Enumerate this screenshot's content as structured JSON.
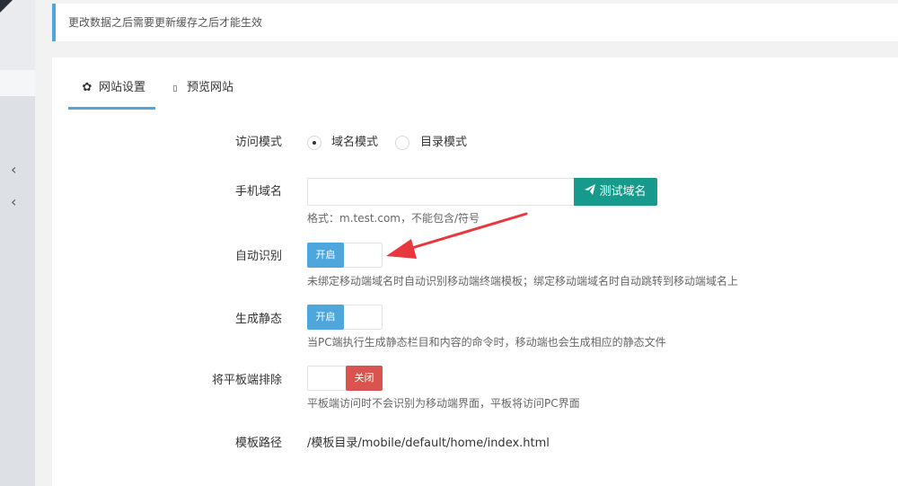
{
  "notice": "更改数据之后需要更新缓存之后才能生效",
  "tabs": [
    {
      "label": "网站设置",
      "icon": "gear-icon"
    },
    {
      "label": "预览网站",
      "icon": "monitor-icon"
    }
  ],
  "form": {
    "access_mode": {
      "label": "访问模式",
      "options": [
        "域名模式",
        "目录模式"
      ],
      "selected": "域名模式"
    },
    "mobile_domain": {
      "label": "手机域名",
      "value": "",
      "button": "测试域名",
      "help": "格式：m.test.com，不能包含/符号"
    },
    "auto_detect": {
      "label": "自动识别",
      "state": "开启",
      "help": "未绑定移动端域名时自动识别移动端终端模板；绑定移动端域名时自动跳转到移动端域名上"
    },
    "generate_static": {
      "label": "生成静态",
      "state": "开启",
      "help": "当PC端执行生成静态栏目和内容的命令时，移动端也会生成相应的静态文件"
    },
    "exclude_tablet": {
      "label": "将平板端排除",
      "state": "关闭",
      "help": "平板端访问时不会识别为移动端界面，平板将访问PC界面"
    },
    "template_path": {
      "label": "模板路径",
      "value": "/模板目录/mobile/default/home/index.html"
    }
  },
  "colors": {
    "accent": "#4ea7dc",
    "test_button": "#159a8b",
    "off": "#d9534f",
    "annotation_arrow": "#e8383d"
  }
}
